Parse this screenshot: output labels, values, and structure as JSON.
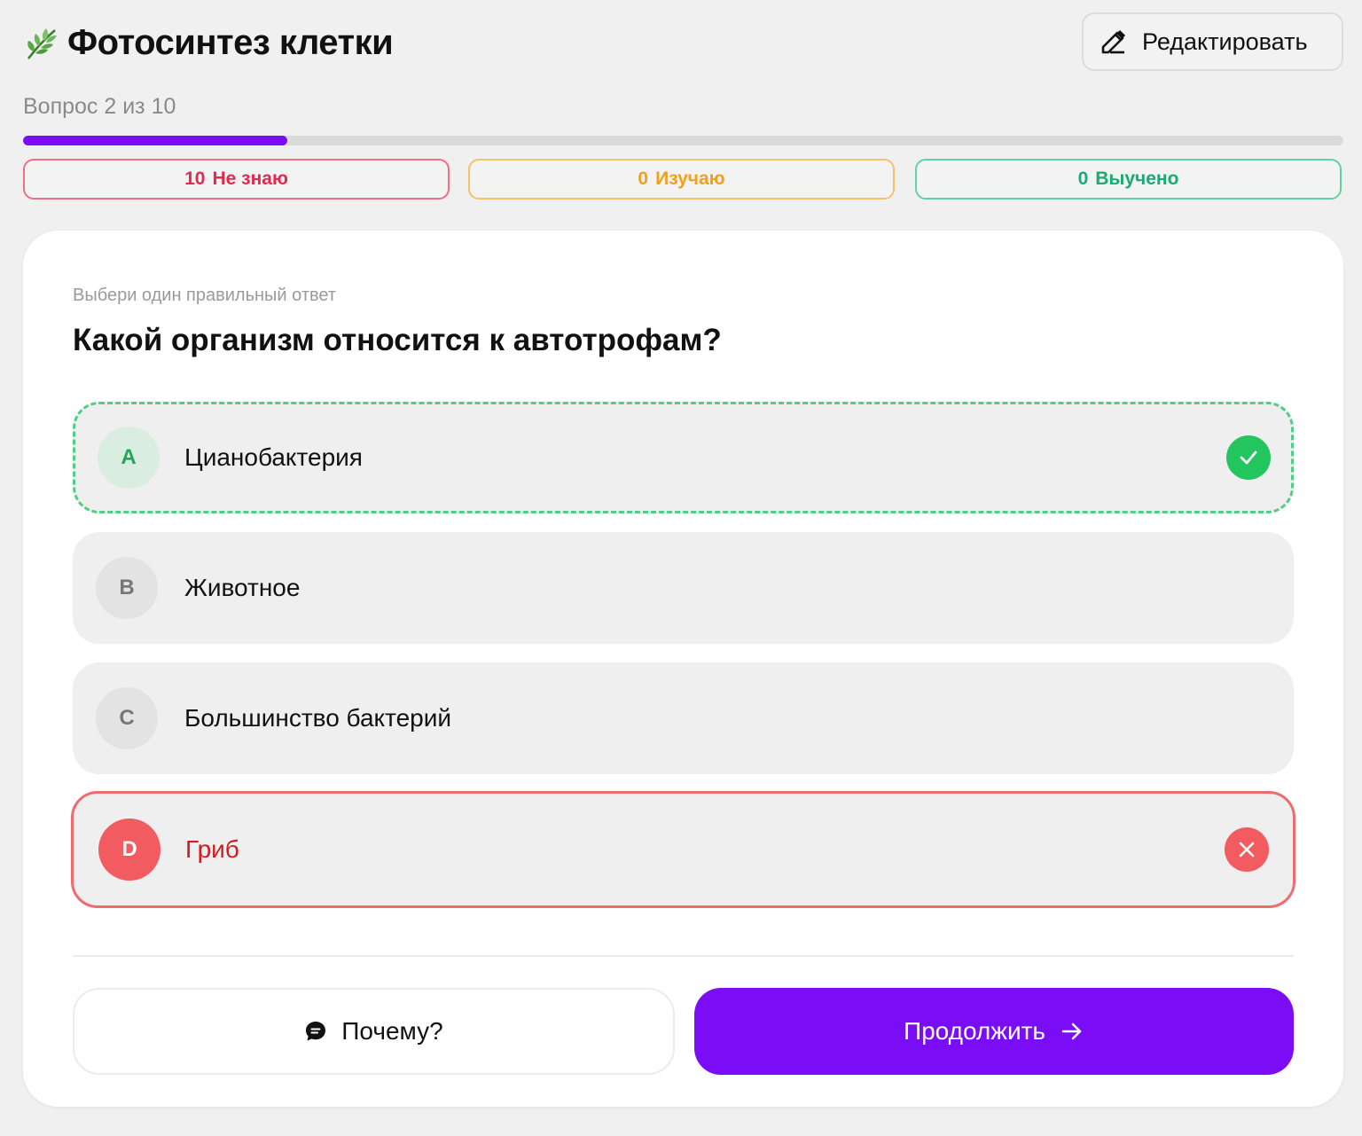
{
  "header": {
    "title": "Фотосинтез клетки",
    "logo_icon": "leaf-icon",
    "edit_label": "Редактировать",
    "edit_icon": "pencil-icon"
  },
  "progress": {
    "text": "Вопрос 2 из 10",
    "current": 2,
    "total": 10,
    "fill_fraction": 0.2,
    "accent_color": "#7a0df5"
  },
  "stats": {
    "unknown": {
      "count": "10",
      "label": "Не знаю",
      "color": "#e2294f"
    },
    "learning": {
      "count": "0",
      "label": "Изучаю",
      "color": "#f0a019"
    },
    "learned": {
      "count": "0",
      "label": "Выучено",
      "color": "#17ac73"
    }
  },
  "quiz": {
    "hint": "Выбери один правильный ответ",
    "question": "Какой организм относится к автотрофам?",
    "options": [
      {
        "letter": "A",
        "text": "Цианобактерия",
        "state": "correct",
        "status_icon": "check-icon"
      },
      {
        "letter": "B",
        "text": "Животное",
        "state": "neutral"
      },
      {
        "letter": "C",
        "text": "Большинство бактерий",
        "state": "neutral"
      },
      {
        "letter": "D",
        "text": "Гриб",
        "state": "wrong",
        "status_icon": "close-icon"
      }
    ]
  },
  "actions": {
    "why_label": "Почему?",
    "why_icon": "chat-bubble-icon",
    "next_label": "Продолжить",
    "next_icon": "arrow-right-icon"
  }
}
